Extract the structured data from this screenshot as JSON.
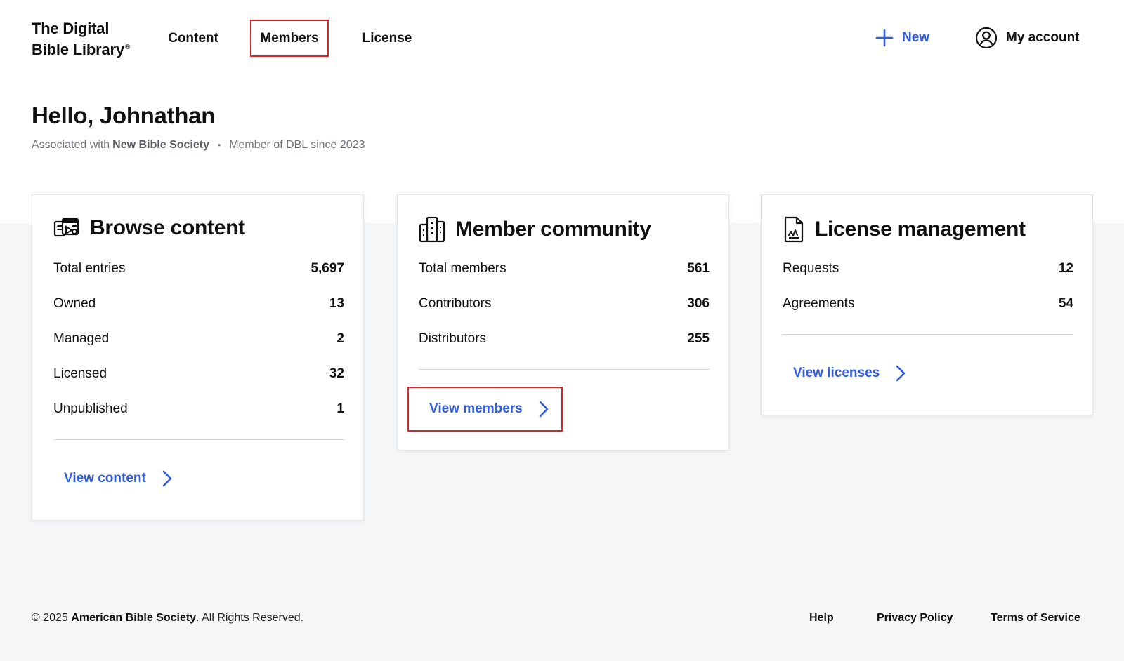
{
  "logo": {
    "line1": "The Digital",
    "line2": "Bible Library",
    "mark": "®"
  },
  "nav": {
    "content": "Content",
    "members": "Members",
    "license": "License"
  },
  "actions": {
    "new_label": "New",
    "account_label": "My account"
  },
  "greeting": {
    "title": "Hello, Johnathan",
    "associated_prefix": "Associated with",
    "organization": "New Bible Society",
    "separator": "•",
    "member_since": "Member of DBL since 2023"
  },
  "cards": {
    "browse": {
      "title": "Browse content",
      "icon": "media-library-icon",
      "stats": [
        {
          "label": "Total entries",
          "value": "5,697"
        },
        {
          "label": "Owned",
          "value": "13"
        },
        {
          "label": "Managed",
          "value": "2"
        },
        {
          "label": "Licensed",
          "value": "32"
        },
        {
          "label": "Unpublished",
          "value": "1"
        }
      ],
      "link": "View content"
    },
    "community": {
      "title": "Member community",
      "icon": "buildings-icon",
      "stats": [
        {
          "label": "Total members",
          "value": "561"
        },
        {
          "label": "Contributors",
          "value": "306"
        },
        {
          "label": "Distributors",
          "value": "255"
        }
      ],
      "link": "View members"
    },
    "license": {
      "title": "License management",
      "icon": "document-signature-icon",
      "stats": [
        {
          "label": "Requests",
          "value": "12"
        },
        {
          "label": "Agreements",
          "value": "54"
        }
      ],
      "link": "View licenses"
    }
  },
  "footer": {
    "copyright_prefix": "© 2025",
    "org_link": "American Bible Society",
    "copyright_suffix": ". All Rights Reserved.",
    "help": "Help",
    "privacy": "Privacy Policy",
    "terms": "Terms of Service"
  },
  "colors": {
    "accent": "#2f5be0",
    "highlight": "#d9262b",
    "background": "#f5f6f8"
  }
}
